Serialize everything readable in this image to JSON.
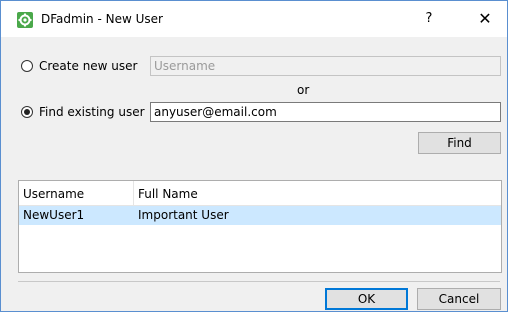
{
  "window": {
    "title": "DFadmin - New User",
    "help_label": "?",
    "close_label": "✕"
  },
  "create_option": {
    "label": "Create new user",
    "selected": false,
    "username_placeholder": "Username",
    "username_value": ""
  },
  "or_label": "or",
  "find_option": {
    "label": "Find existing user",
    "selected": true,
    "search_value": "anyuser@email.com"
  },
  "find_button_label": "Find",
  "results_table": {
    "columns": [
      "Username",
      "Full Name"
    ],
    "sort_indicator": "^",
    "rows": [
      {
        "username": "NewUser1",
        "full_name": "Important User",
        "selected": true
      }
    ]
  },
  "footer": {
    "ok_label": "OK",
    "cancel_label": "Cancel"
  },
  "colors": {
    "selection": "#cce8ff",
    "accent": "#0078d7",
    "window_border": "#5a8fd0",
    "dialog_bg": "#f0f0f0",
    "app_icon_green": "#4aa84a"
  },
  "icons": {
    "app": "gear-icon",
    "close": "close-icon",
    "sort": "sort-ascending-icon"
  }
}
